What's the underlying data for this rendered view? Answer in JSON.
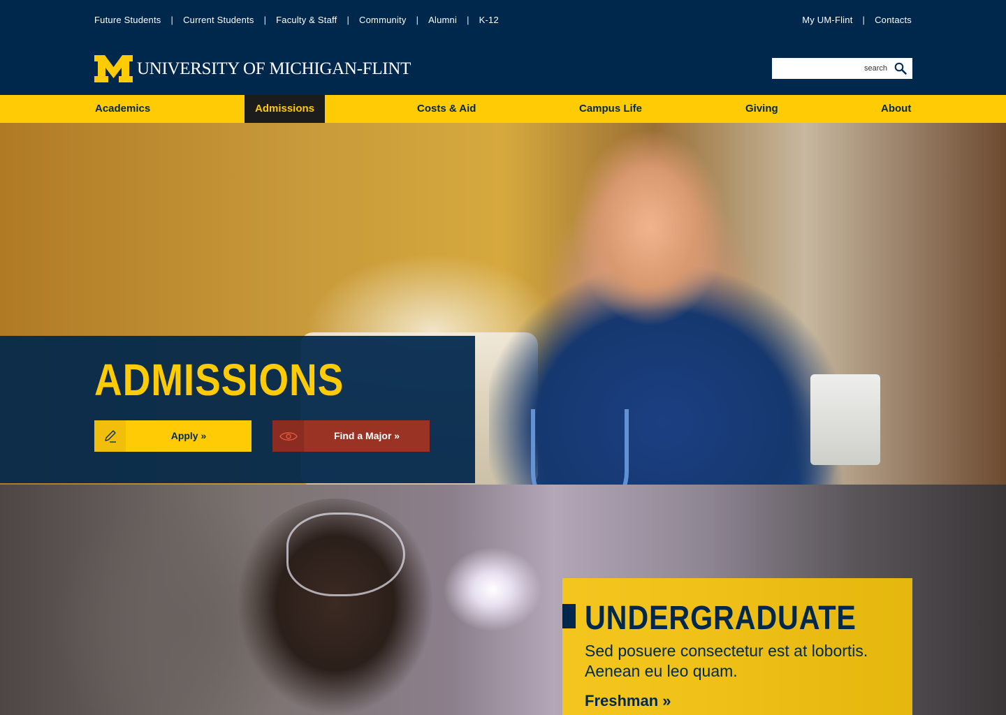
{
  "utility": {
    "left_links": [
      "Future Students",
      "Current Students",
      "Faculty & Staff",
      "Community",
      "Alumni",
      "K-12"
    ],
    "right_links": [
      "My UM-Flint",
      "Contacts"
    ],
    "separator": "|"
  },
  "header": {
    "logo_text": "UNIVERSITY OF MICHIGAN-FLINT",
    "search": {
      "placeholder": "search"
    }
  },
  "nav": {
    "items": [
      "Academics",
      "Admissions",
      "Costs & Aid",
      "Campus Life",
      "Giving",
      "About"
    ],
    "active": "Admissions"
  },
  "hero": {
    "title": "ADMISSIONS",
    "apply_label": "Apply »",
    "major_label": "Find a Major »"
  },
  "undergraduate": {
    "title": "UNDERGRADUATE",
    "description": "Sed posuere consectetur est at lobortis. Aenean eu leo quam.",
    "link": "Freshman »"
  },
  "colors": {
    "navy": "#00274c",
    "maize": "#ffcb05",
    "active_nav": "#1c1c1c",
    "major_button": "#9a3324"
  },
  "icons": {
    "logo": "block-m-logo",
    "search": "search-icon",
    "apply": "pencil-icon",
    "major": "eye-icon"
  }
}
